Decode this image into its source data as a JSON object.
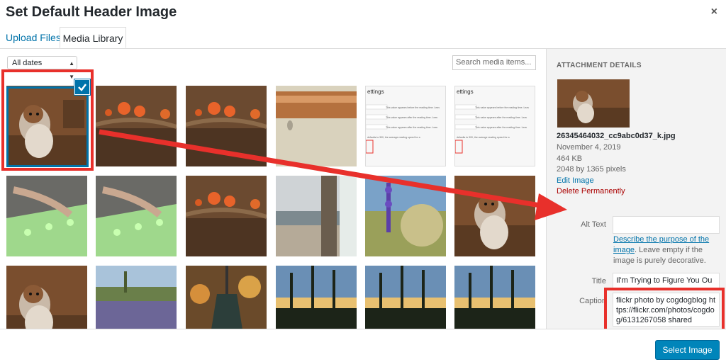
{
  "header": {
    "title": "Set Default Header Image",
    "close_label": "×"
  },
  "tabs": [
    {
      "label": "Upload Files"
    },
    {
      "label": "Media Library"
    }
  ],
  "toolbar": {
    "date_filter": "All dates",
    "search_placeholder": "Search media items..."
  },
  "sidebar": {
    "heading": "ATTACHMENT DETAILS",
    "filename": "26345464032_cc9abc0d37_k.jpg",
    "date": "November 4, 2019",
    "filesize": "464 KB",
    "dimensions": "2048 by 1365 pixels",
    "edit_link": "Edit Image",
    "delete_link": "Delete Permanently",
    "alt_label": "Alt Text",
    "alt_value": "",
    "describe_link": "Describe the purpose of the image",
    "describe_rest": ". Leave empty if the image is purely decorative.",
    "title_label": "Title",
    "title_value": "Il'm Trying to Figure You Ou",
    "caption_label": "Caption",
    "caption_value": "flickr photo by cogdogblog https://flickr.com/photos/cogdog/6131267058 shared"
  },
  "footer": {
    "select_button": "Select Image"
  },
  "screenshot_text": {
    "heading": "ettings",
    "lines": [
      "This value appears before the reading time. Leav",
      "This value appears after the reading time. Leav",
      "This value appears after the reading time. Leav",
      "defaults to 300, the average reading speed for a"
    ]
  },
  "colors": {
    "accent": "#0073aa",
    "annotation_red": "#e8302b",
    "button": "#0085ba"
  }
}
